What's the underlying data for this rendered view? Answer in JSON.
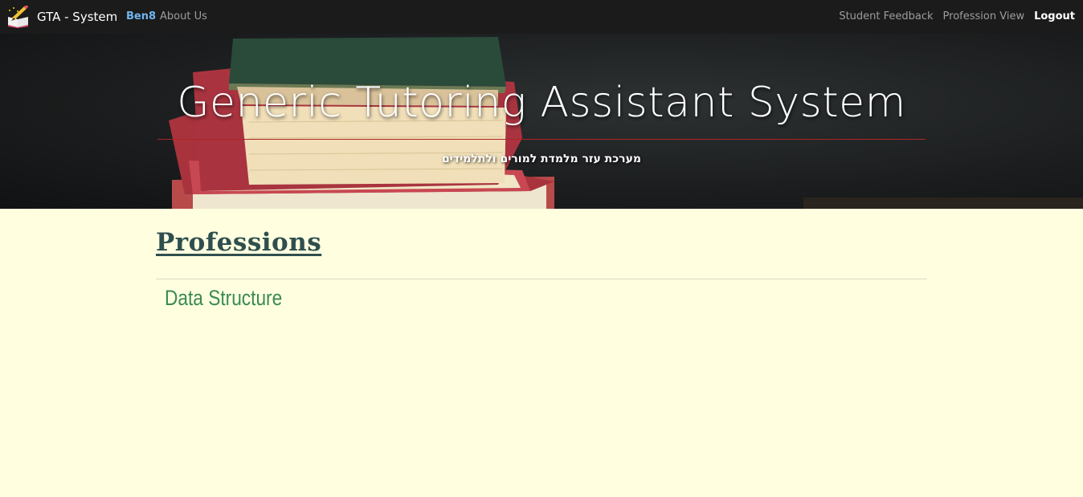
{
  "navbar": {
    "brand": "GTA - System",
    "user": "Ben8",
    "about": "About Us",
    "right_links": [
      "Student Feedback",
      "Profession View"
    ],
    "logout": "Logout"
  },
  "hero": {
    "title": "Generic Tutoring Assistant System",
    "subtitle": "מערכת עזר מלמדת למורים ולתלמידים"
  },
  "main": {
    "section_title": "Professions",
    "professions": [
      "Data Structure"
    ]
  },
  "colors": {
    "navbar_bg": "#1b1b1b",
    "page_bg": "#ffffe0",
    "accent_user": "#6fb6f0",
    "section_title": "#2f4f4f",
    "profession_link": "#3a8a55",
    "hero_line": "#b02424"
  },
  "icons": {
    "brand": "book-pencil-logo-icon"
  }
}
